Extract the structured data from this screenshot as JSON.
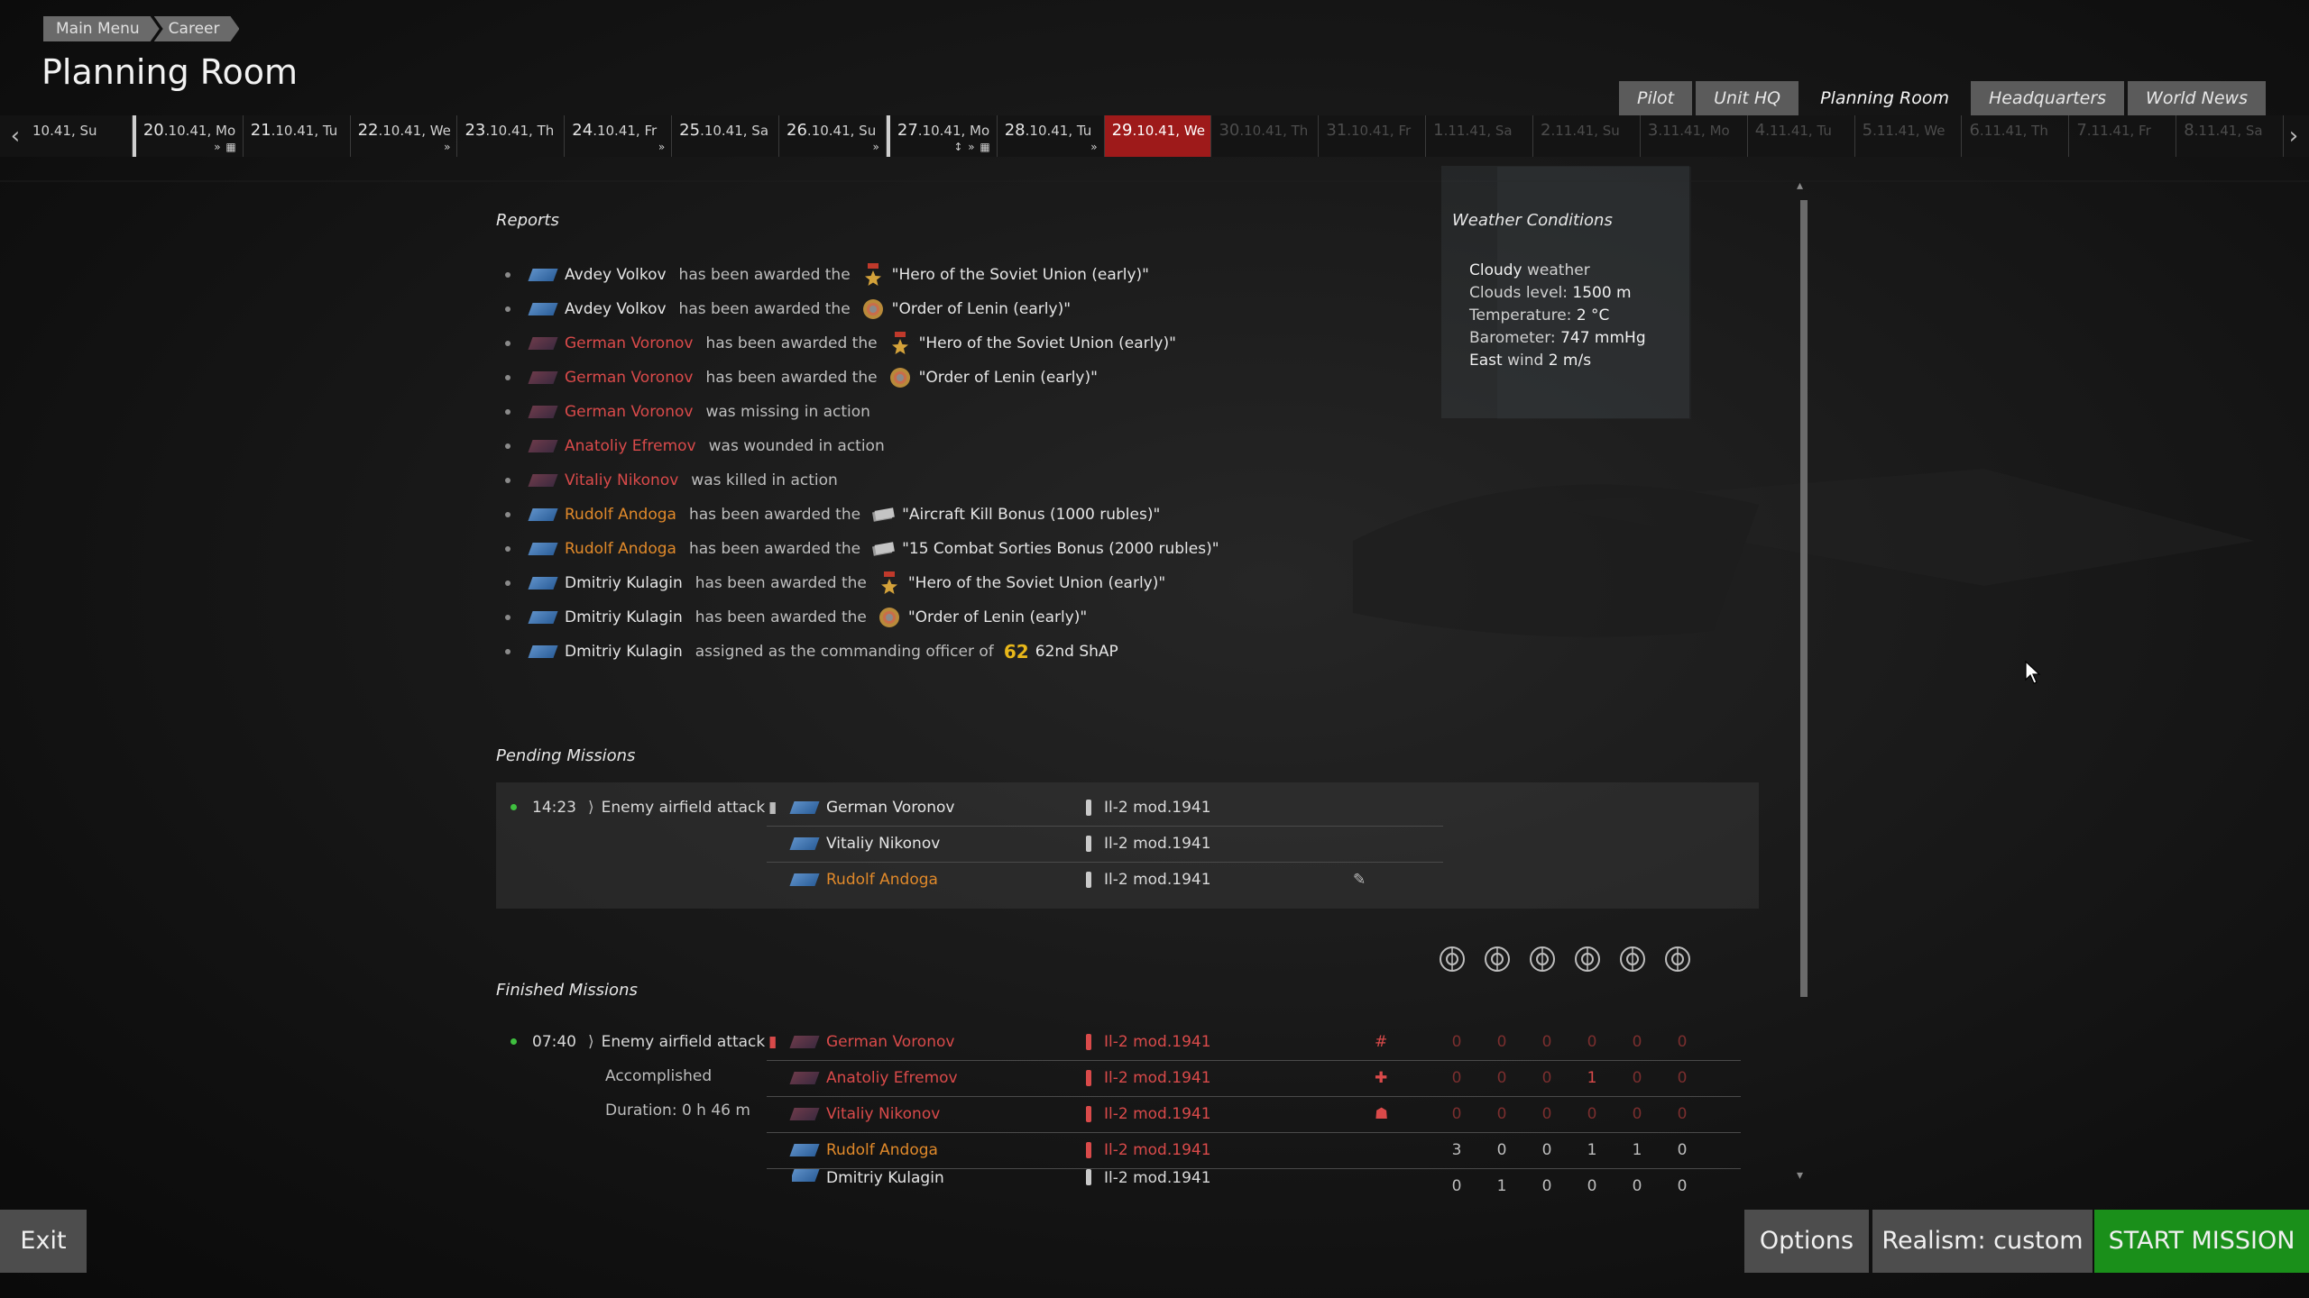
{
  "breadcrumb": [
    "Main Menu",
    "Career"
  ],
  "page_title": "Planning Room",
  "top_tabs": [
    {
      "label": "Pilot",
      "active": false
    },
    {
      "label": "Unit HQ",
      "active": false
    },
    {
      "label": "Planning Room",
      "active": true
    },
    {
      "label": "Headquarters",
      "active": false
    },
    {
      "label": "World News",
      "active": false
    }
  ],
  "calendar": [
    {
      "day": "",
      "rest": "10.41, Su",
      "marks": ""
    },
    {
      "day": "20",
      "rest": ".10.41, Mo",
      "marks": "» ▦"
    },
    {
      "day": "21",
      "rest": ".10.41, Tu",
      "marks": ""
    },
    {
      "day": "22",
      "rest": ".10.41, We",
      "marks": "»"
    },
    {
      "day": "23",
      "rest": ".10.41, Th",
      "marks": ""
    },
    {
      "day": "24",
      "rest": ".10.41, Fr",
      "marks": "»"
    },
    {
      "day": "25",
      "rest": ".10.41, Sa",
      "marks": ""
    },
    {
      "day": "26",
      "rest": ".10.41, Su",
      "marks": "»"
    },
    {
      "day": "27",
      "rest": ".10.41, Mo",
      "marks": "↕ » ▦"
    },
    {
      "day": "28",
      "rest": ".10.41, Tu",
      "marks": "»"
    },
    {
      "day": "29",
      "rest": ".10.41, We",
      "marks": ""
    },
    {
      "day": "30",
      "rest": ".10.41, Th",
      "marks": ""
    },
    {
      "day": "31",
      "rest": ".10.41, Fr",
      "marks": ""
    },
    {
      "day": "1",
      "rest": ".11.41, Sa",
      "marks": ""
    },
    {
      "day": "2",
      "rest": ".11.41, Su",
      "marks": ""
    },
    {
      "day": "3",
      "rest": ".11.41, Mo",
      "marks": ""
    },
    {
      "day": "4",
      "rest": ".11.41, Tu",
      "marks": ""
    },
    {
      "day": "5",
      "rest": ".11.41, We",
      "marks": ""
    },
    {
      "day": "6",
      "rest": ".11.41, Th",
      "marks": ""
    },
    {
      "day": "7",
      "rest": ".11.41, Fr",
      "marks": ""
    },
    {
      "day": "8",
      "rest": ".11.41, Sa",
      "marks": ""
    }
  ],
  "reports_title": "Reports",
  "reports": [
    {
      "name": "Avdey Volkov",
      "name_style": "",
      "flag": "blue",
      "action": "has been awarded the",
      "icon": "hero-star-icon",
      "award": "\"Hero of the Soviet Union (early)\""
    },
    {
      "name": "Avdey Volkov",
      "name_style": "",
      "flag": "blue",
      "action": "has been awarded the",
      "icon": "order-lenin-icon",
      "award": "\"Order of Lenin (early)\""
    },
    {
      "name": "German Voronov",
      "name_style": "red",
      "flag": "red",
      "action": "has been awarded the",
      "icon": "hero-star-icon",
      "award": "\"Hero of the Soviet Union (early)\""
    },
    {
      "name": "German Voronov",
      "name_style": "red",
      "flag": "red",
      "action": "has been awarded the",
      "icon": "order-lenin-icon",
      "award": "\"Order of Lenin (early)\""
    },
    {
      "name": "German Voronov",
      "name_style": "red",
      "flag": "red",
      "action": "was missing in action",
      "icon": "",
      "award": ""
    },
    {
      "name": "Anatoliy Efremov",
      "name_style": "red",
      "flag": "red",
      "action": "was wounded in action",
      "icon": "",
      "award": ""
    },
    {
      "name": "Vitaliy Nikonov",
      "name_style": "red",
      "flag": "red",
      "action": "was killed in action",
      "icon": "",
      "award": ""
    },
    {
      "name": "Rudolf Andoga",
      "name_style": "orange",
      "flag": "blue",
      "action": "has been awarded the",
      "icon": "money-bonus-icon",
      "award": "\"Aircraft Kill Bonus (1000 rubles)\""
    },
    {
      "name": "Rudolf Andoga",
      "name_style": "orange",
      "flag": "blue",
      "action": "has been awarded the",
      "icon": "money-bonus-icon",
      "award": "\"15 Combat Sorties Bonus (2000 rubles)\""
    },
    {
      "name": "Dmitriy Kulagin",
      "name_style": "",
      "flag": "blue",
      "action": "has been awarded the",
      "icon": "hero-star-icon",
      "award": "\"Hero of the Soviet Union (early)\""
    },
    {
      "name": "Dmitriy Kulagin",
      "name_style": "",
      "flag": "blue",
      "action": "has been awarded the",
      "icon": "order-lenin-icon",
      "award": "\"Order of Lenin (early)\""
    },
    {
      "name": "Dmitriy Kulagin",
      "name_style": "",
      "flag": "blue",
      "action": "assigned as the commanding officer of",
      "icon": "unit-62-icon",
      "award": "62nd ShAP"
    }
  ],
  "unit_badge": "62",
  "weather": {
    "title": "Weather Conditions",
    "line1_value": "Cloudy",
    "line1_label": " weather",
    "line2_label": "Clouds level: ",
    "line2_value": "1500 m",
    "line3_label": "Temperature: ",
    "line3_value": "2 °C",
    "line4_label": "Barometer: ",
    "line4_value": "747 mmHg",
    "line5_value": "East",
    "line5_label": " wind ",
    "line5_value2": "2 m/s"
  },
  "pending": {
    "title": "Pending Missions",
    "time": "14:23",
    "type": "Enemy airfield attack",
    "pilots": [
      {
        "name": "German Voronov",
        "name_style": "",
        "aircraft": "Il-2 mod.1941",
        "edit": false
      },
      {
        "name": "Vitaliy Nikonov",
        "name_style": "",
        "aircraft": "Il-2 mod.1941",
        "edit": false
      },
      {
        "name": "Rudolf Andoga",
        "name_style": "orange",
        "aircraft": "Il-2 mod.1941",
        "edit": true
      }
    ]
  },
  "finished": {
    "title": "Finished Missions",
    "time": "07:40",
    "type": "Enemy airfield attack",
    "status": "Accomplished",
    "duration": "Duration: 0 h 46 m",
    "stat_icons": [
      "aircraft-kills-icon",
      "ground-target-icon",
      "vehicle-target-icon",
      "artillery-target-icon",
      "ship-target-icon",
      "structure-target-icon"
    ],
    "pilots": [
      {
        "name": "German Voronov",
        "name_style": "red",
        "flag": "red",
        "aircraft": "Il-2 mod.1941",
        "aircraft_style": "red",
        "status_icon": "#",
        "stats": [
          "0",
          "0",
          "0",
          "0",
          "0",
          "0"
        ]
      },
      {
        "name": "Anatoliy Efremov",
        "name_style": "red",
        "flag": "red",
        "aircraft": "Il-2 mod.1941",
        "aircraft_style": "red",
        "status_icon": "✚",
        "stats": [
          "0",
          "0",
          "0",
          "1",
          "0",
          "0"
        ]
      },
      {
        "name": "Vitaliy Nikonov",
        "name_style": "red",
        "flag": "red",
        "aircraft": "Il-2 mod.1941",
        "aircraft_style": "red",
        "status_icon": "☗",
        "stats": [
          "0",
          "0",
          "0",
          "0",
          "0",
          "0"
        ]
      },
      {
        "name": "Rudolf Andoga",
        "name_style": "orange",
        "flag": "blue",
        "aircraft": "Il-2 mod.1941",
        "aircraft_style": "red",
        "status_icon": "",
        "stats": [
          "3",
          "0",
          "0",
          "1",
          "1",
          "0"
        ]
      },
      {
        "name": "Dmitriy Kulagin",
        "name_style": "",
        "flag": "blue",
        "aircraft": "Il-2 mod.1941",
        "aircraft_style": "",
        "status_icon": "",
        "stats": [
          "0",
          "1",
          "0",
          "0",
          "0",
          "0"
        ]
      }
    ]
  },
  "buttons": {
    "exit": "Exit",
    "options": "Options",
    "realism": "Realism: custom",
    "start": "START MISSION"
  },
  "colors": {
    "accent_red": "#9e1a1a",
    "start_green": "#1a8f1a",
    "name_red": "#d94a4a",
    "name_orange": "#e0892a"
  }
}
